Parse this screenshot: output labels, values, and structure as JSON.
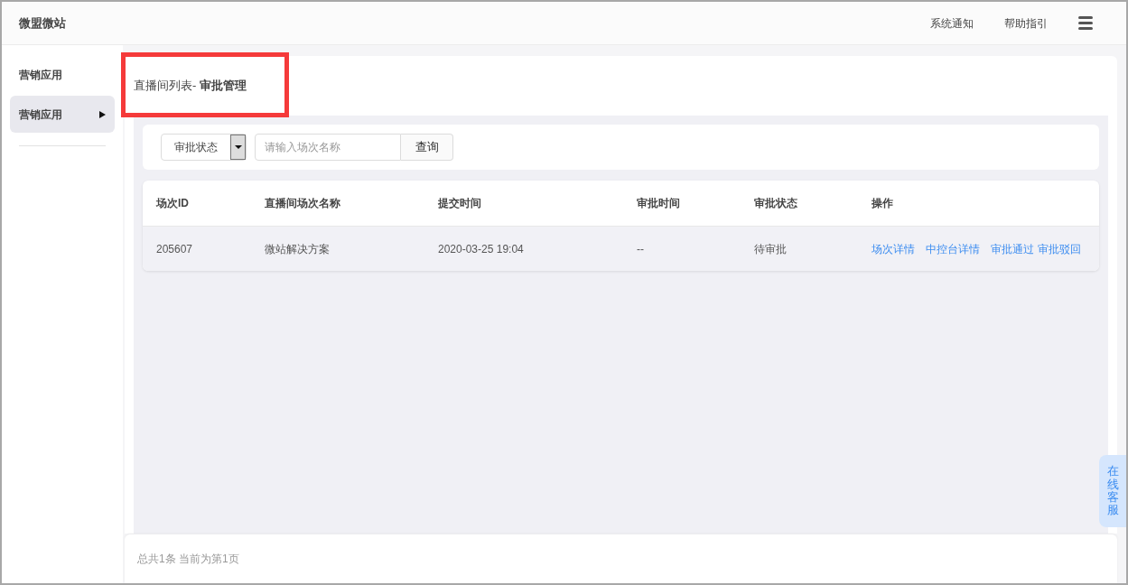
{
  "header": {
    "brand": "微盟微站",
    "links": [
      "系统通知",
      "帮助指引"
    ]
  },
  "sidebar": {
    "items": [
      {
        "kind": "heading",
        "label": "营销应用"
      },
      {
        "kind": "item",
        "label": "营销应用",
        "selected": true
      }
    ]
  },
  "page_title": "直播间列表- **审批管理**",
  "filter": {
    "status_select": "审批状态",
    "search": {
      "placeholder": "请输入场次名称"
    },
    "button": "查询"
  },
  "table": {
    "columns": [
      "场次ID",
      "直播间场次名称",
      "提交时间",
      "审批时间",
      "审批状态",
      "操作"
    ],
    "rows": [
      {
        "cells": [
          "205607",
          "微站解决方案",
          "2020-03-25 19:04",
          "--",
          "待审批"
        ],
        "actions": [
          "场次详情",
          "中控台详情",
          "审批通过",
          "审批驳回"
        ]
      }
    ]
  },
  "footer": "总共1条 当前为第1页",
  "support_tab": "在线客服"
}
